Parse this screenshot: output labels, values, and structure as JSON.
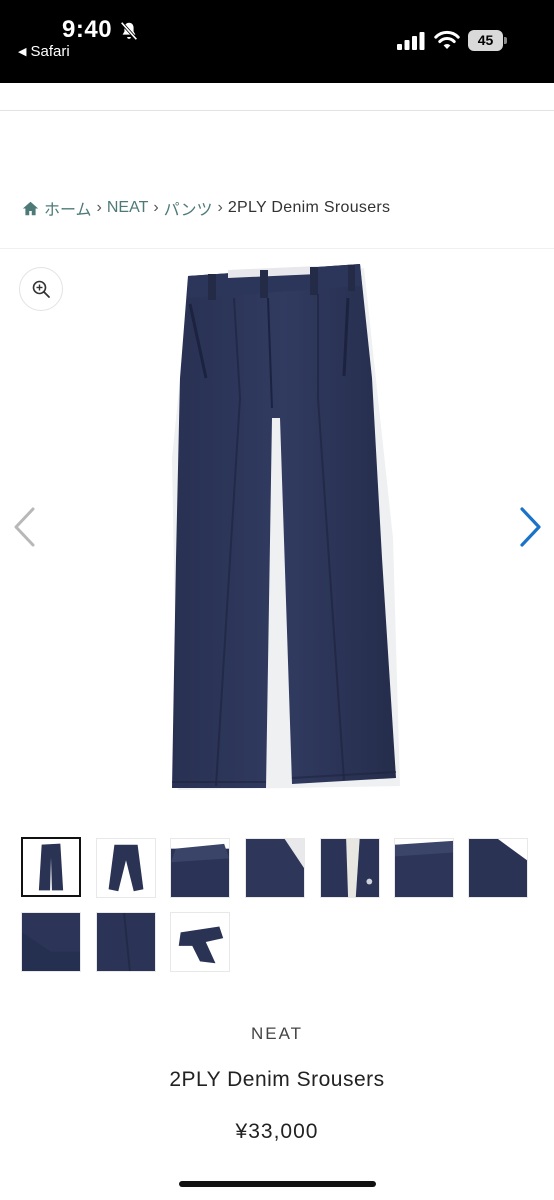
{
  "status_bar": {
    "time": "9:40",
    "back_label": "Safari",
    "battery": "45",
    "icons": [
      "bell-slash-icon",
      "signal-icon",
      "wifi-icon",
      "battery-icon"
    ]
  },
  "breadcrumb": {
    "home": "ホーム",
    "items": [
      "NEAT",
      "パンツ"
    ],
    "current": "2PLY Denim Srousers",
    "separator": "›"
  },
  "gallery": {
    "thumbnail_count": 10,
    "selected_index": 0,
    "icons": [
      "zoom-in-icon",
      "chevron-left-icon",
      "chevron-right-icon"
    ]
  },
  "product": {
    "brand": "NEAT",
    "title": "2PLY Denim Srousers",
    "price": "¥33,000"
  },
  "colors": {
    "denim": "#2a3354",
    "link": "#4d7a77",
    "arrow_active": "#1a73c9"
  }
}
